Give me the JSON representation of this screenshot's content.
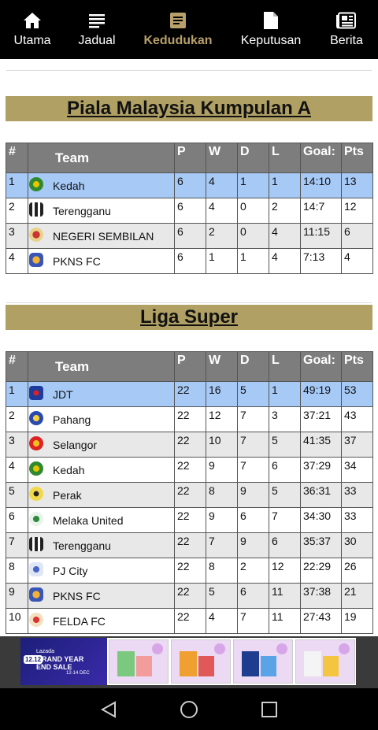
{
  "nav": [
    {
      "label": "Utama",
      "icon": "home-icon"
    },
    {
      "label": "Jadual",
      "icon": "list-icon"
    },
    {
      "label": "Kedudukan",
      "icon": "standings-icon",
      "active": true
    },
    {
      "label": "Keputusan",
      "icon": "document-icon"
    },
    {
      "label": "Berita",
      "icon": "newspaper-icon"
    }
  ],
  "colors": {
    "active_nav": "#b8a06a",
    "title_bar": "#b0a064",
    "header_row": "#7d7d7d",
    "highlight_row": "#a6c9f6",
    "alt_row": "#e8e8e8"
  },
  "table1": {
    "title": "Piala Malaysia Kumpulan A",
    "headers": [
      "#",
      "Team",
      "P",
      "W",
      "D",
      "L",
      "Goal:",
      "Pts"
    ],
    "rows": [
      [
        "1",
        "Kedah",
        "6",
        "4",
        "1",
        "1",
        "14:10",
        "13"
      ],
      [
        "2",
        "Terengganu",
        "6",
        "4",
        "0",
        "2",
        "14:7",
        "12"
      ],
      [
        "3",
        "NEGERI SEMBILAN",
        "6",
        "2",
        "0",
        "4",
        "11:15",
        "6"
      ],
      [
        "4",
        "PKNS FC",
        "6",
        "1",
        "1",
        "4",
        "7:13",
        "4"
      ]
    ]
  },
  "table2": {
    "title": "Liga Super",
    "headers": [
      "#",
      "Team",
      "P",
      "W",
      "D",
      "L",
      "Goal:",
      "Pts"
    ],
    "rows": [
      [
        "1",
        "JDT",
        "22",
        "16",
        "5",
        "1",
        "49:19",
        "53"
      ],
      [
        "2",
        "Pahang",
        "22",
        "12",
        "7",
        "3",
        "37:21",
        "43"
      ],
      [
        "3",
        "Selangor",
        "22",
        "10",
        "7",
        "5",
        "41:35",
        "37"
      ],
      [
        "4",
        "Kedah",
        "22",
        "9",
        "7",
        "6",
        "37:29",
        "34"
      ],
      [
        "5",
        "Perak",
        "22",
        "8",
        "9",
        "5",
        "36:31",
        "33"
      ],
      [
        "6",
        "Melaka United",
        "22",
        "9",
        "6",
        "7",
        "34:30",
        "33"
      ],
      [
        "7",
        "Terengganu",
        "22",
        "7",
        "9",
        "6",
        "35:37",
        "30"
      ],
      [
        "8",
        "PJ City",
        "22",
        "8",
        "2",
        "12",
        "22:29",
        "26"
      ],
      [
        "9",
        "PKNS FC",
        "22",
        "5",
        "6",
        "11",
        "37:38",
        "21"
      ],
      [
        "10",
        "FELDA FC",
        "22",
        "4",
        "7",
        "11",
        "27:43",
        "19"
      ]
    ]
  },
  "ad": {
    "brand": "Lazada",
    "headline": "GRAND YEAR END SALE",
    "badge": "12.12",
    "dates": "12-14 DEC"
  }
}
